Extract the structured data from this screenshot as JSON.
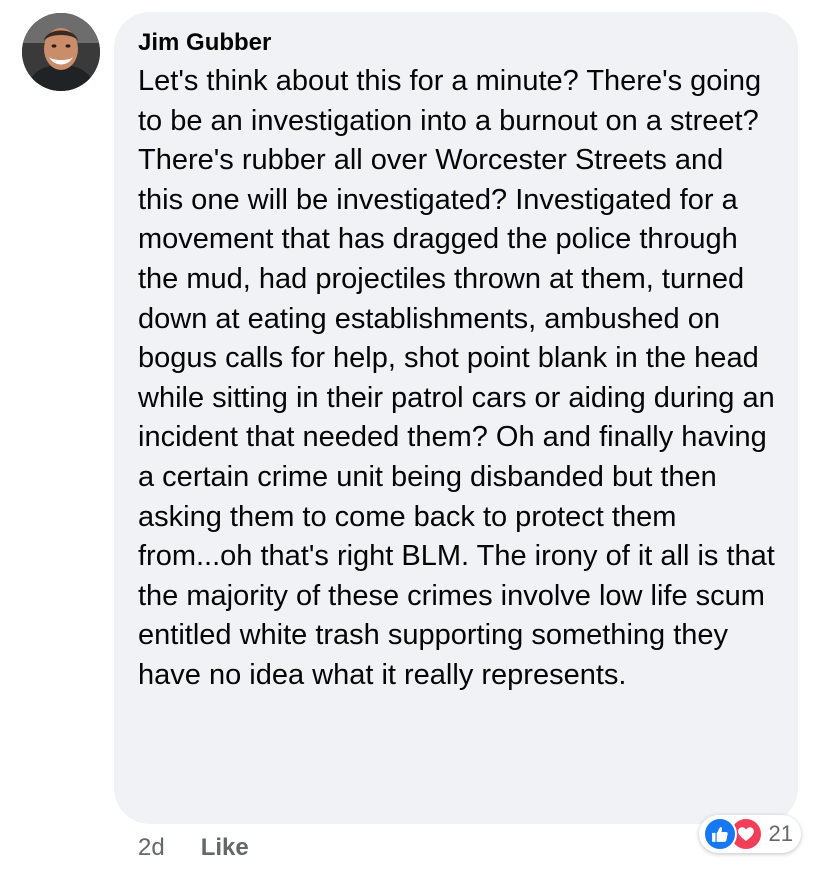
{
  "comment": {
    "author": "Jim Gubber",
    "text": "Let's think about this for a minute? There's going to be an investigation into a burnout on a street? There's rubber all over Worcester Streets and this one will be investigated? Investigated for a movement that has dragged the police through the mud, had projectiles thrown at them, turned down at eating establishments, ambushed on bogus calls for help, shot point blank in the head while sitting in their patrol cars or aiding during an incident that needed them? Oh and finally having a certain crime unit being disbanded but then asking them to come back to protect them from...oh that's right BLM. The irony of it all is that the majority of these crimes involve low life scum entitled white trash supporting something they have no idea what it really represents.",
    "timestamp": "2d",
    "like_label": "Like"
  },
  "reactions": {
    "icons": [
      "like-icon",
      "love-icon"
    ],
    "count": "21",
    "colors": {
      "like": "#1877f2",
      "love": "#f33e58"
    }
  },
  "colors": {
    "bubble": "#f0f2f5",
    "text": "#050505",
    "meta": "#65676b"
  }
}
